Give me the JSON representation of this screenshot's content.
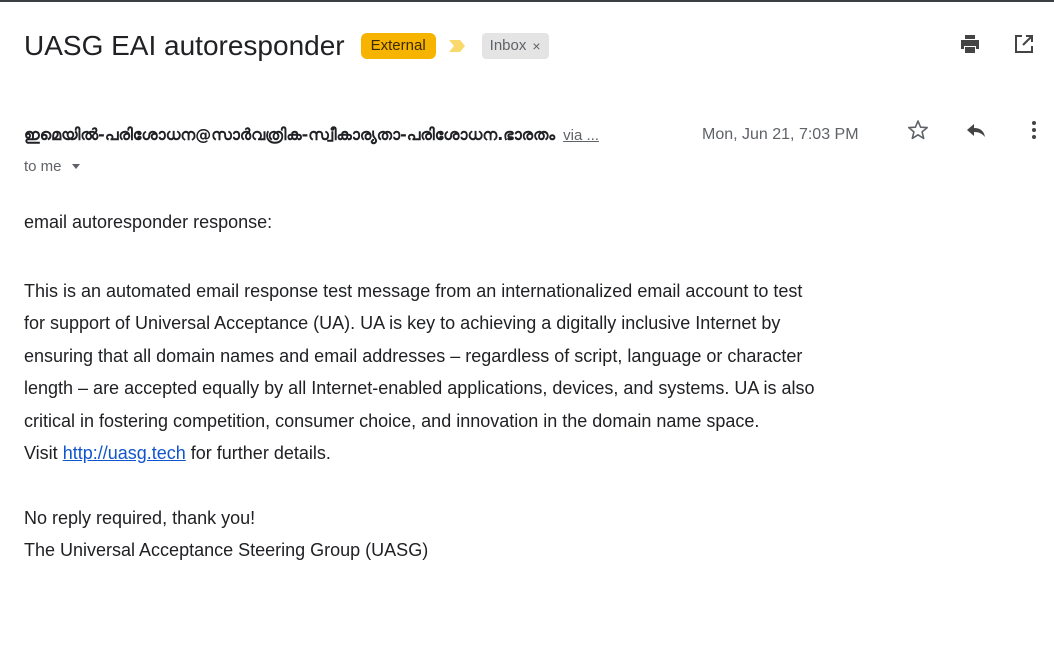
{
  "email": {
    "subject": "UASG EAI autoresponder",
    "labels": {
      "external": "External",
      "inbox": "Inbox",
      "inbox_remove": "×"
    },
    "sender": "ഇമെയിൽ-പരിശോധന@സാർവത്രിക-സ്വീകാര്യതാ-പരിശോധന.ഭാരതം",
    "via": "via ...",
    "date": "Mon, Jun 21, 7:03 PM",
    "recipient": "to me",
    "body": {
      "greeting": "email autoresponder response:",
      "paragraph_lines": [
        "This is an automated email response test message from an internationalized email account to test",
        "for support of Universal Acceptance (UA). UA is key to achieving a digitally inclusive Internet by",
        "ensuring that all domain names and email addresses – regardless of script, language or character",
        "length – are accepted equally by all Internet-enabled applications, devices, and systems. UA is also",
        "critical in fostering competition, consumer choice, and innovation in the domain name space."
      ],
      "visit_prefix": "Visit ",
      "link_text": "http://uasg.tech",
      "visit_suffix": " for further details.",
      "closing": "No reply required, thank you!",
      "signature": "The Universal Acceptance Steering Group (UASG)"
    }
  },
  "icons": {
    "print": "print-icon",
    "open_new": "open-in-new-window-icon",
    "star": "star-icon",
    "reply": "reply-icon",
    "more": "more-vert-icon",
    "importance": "importance-marker-icon",
    "caret": "caret-down-icon"
  },
  "colors": {
    "external_badge": "#f6b400",
    "importance_marker": "#f9d96b",
    "inbox_badge": "#e4e4e4",
    "link": "#1155cc"
  }
}
